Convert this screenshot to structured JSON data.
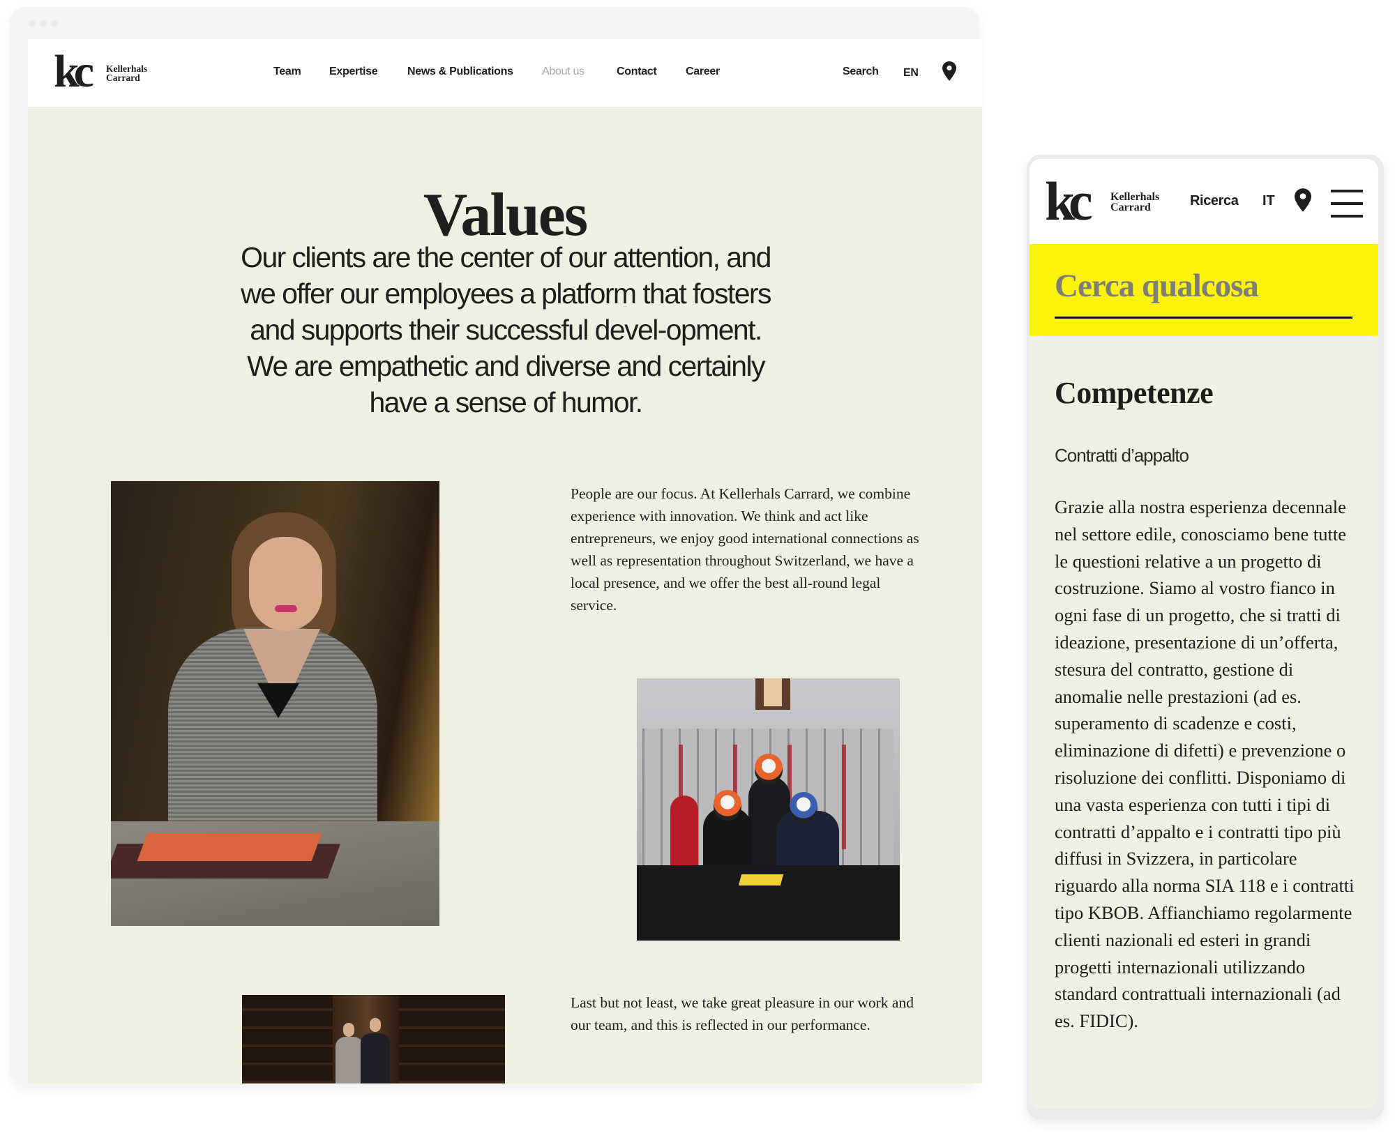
{
  "desktop": {
    "brand": {
      "mark": "kc",
      "name_line1": "Kellerhals",
      "name_line2": "Carrard"
    },
    "nav": [
      {
        "label": "Team",
        "active": false
      },
      {
        "label": "Expertise",
        "active": false
      },
      {
        "label": "News & Publications",
        "active": false
      },
      {
        "label": "About us",
        "active": true
      },
      {
        "label": "Contact",
        "active": false
      },
      {
        "label": "Career",
        "active": false
      }
    ],
    "search_label": "Search",
    "language": "EN",
    "location_icon": "map-pin-icon",
    "page_title": "Values",
    "intro": "Our clients are the center of our attention, and we offer our employees a platform that fosters and supports their successful devel-opment. We are empathetic and diverse and certainly have a sense of humor.",
    "paragraph_1": "People are our focus. At Kellerhals Carrard, we combine experience with innovation. We think and act like entrepreneurs, we enjoy good international connections as well as representation throughout Switzerland, we have a local presence, and we offer the best all-round legal service.",
    "paragraph_2": "Last but not least, we take great pleasure in our work and our team, and this is reflected in our performance.",
    "photos": [
      {
        "subject": "Woman in grey check dress seated at table with notebook"
      },
      {
        "subject": "Three people wearing racing helmets at a meeting table in front of bookshelves"
      },
      {
        "subject": "Two smiling people standing in a library"
      }
    ]
  },
  "mobile": {
    "brand": {
      "mark": "kc",
      "name_line1": "Kellerhals",
      "name_line2": "Carrard"
    },
    "search_label": "Ricerca",
    "language": "IT",
    "location_icon": "map-pin-icon",
    "menu_icon": "hamburger-menu-icon",
    "search_placeholder": "Cerca qualcosa",
    "section_title": "Competenze",
    "section_subtitle": "Contratti d’appalto",
    "section_body": "Grazie alla nostra esperienza decennale nel settore edile, conosciamo bene tutte le questioni relative a un progetto di costruzione. Siamo al vostro fianco in ogni fase di un progetto, che si tratti di ideazione, presentazione di un’offerta, stesura del contratto, gestione di anomalie nelle prestazioni (ad es. superamento di scadenze e costi, eliminazione di difetti) e prevenzione o risoluzione dei conflitti. Disponiamo di una vasta esperienza con tutti i tipi di contratti d’appalto e i contratti tipo più diffusi in Svizzera, in particolare riguardo alla norma SIA 118 e i contratti tipo KBOB. Affianchiamo regolarmente clienti nazionali ed esteri in grandi progetti internazionali utilizzando standard contrattuali internazionali (ad es. FIDIC)."
  },
  "colors": {
    "page_background": "#efefe2",
    "header_background": "#ffffff",
    "search_band": "#fcf20d",
    "text": "#1e1e1e",
    "nav_active": "#a9a9a5"
  }
}
